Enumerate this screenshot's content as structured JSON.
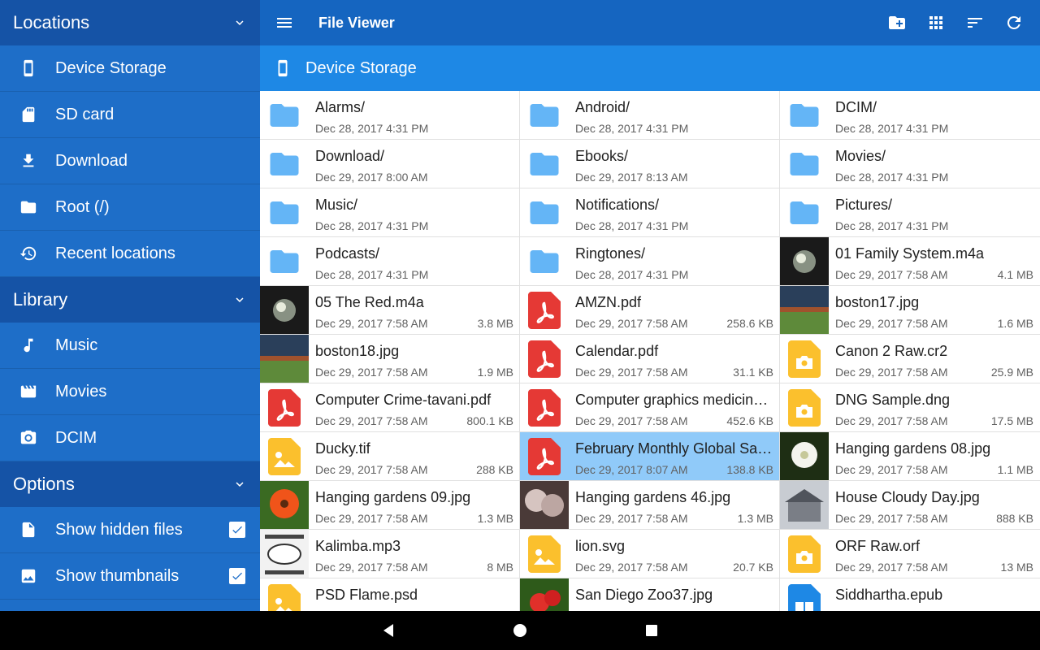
{
  "sidebar": {
    "sections": [
      {
        "title": "Locations",
        "items": [
          {
            "label": "Device Storage",
            "icon": "phone-icon"
          },
          {
            "label": "SD card",
            "icon": "sd-card-icon"
          },
          {
            "label": "Download",
            "icon": "download-icon"
          },
          {
            "label": "Root (/)",
            "icon": "folder-icon"
          },
          {
            "label": "Recent locations",
            "icon": "history-icon"
          }
        ]
      },
      {
        "title": "Library",
        "items": [
          {
            "label": "Music",
            "icon": "music-note-icon"
          },
          {
            "label": "Movies",
            "icon": "movie-icon"
          },
          {
            "label": "DCIM",
            "icon": "camera-icon"
          }
        ]
      },
      {
        "title": "Options",
        "items": [
          {
            "label": "Show hidden files",
            "icon": "file-icon",
            "checked": true
          },
          {
            "label": "Show thumbnails",
            "icon": "image-icon",
            "checked": true
          }
        ]
      }
    ]
  },
  "topbar": {
    "title": "File Viewer",
    "actions": [
      "new-folder-icon",
      "grid-view-icon",
      "sort-icon",
      "refresh-icon"
    ]
  },
  "pathbar": {
    "label": "Device Storage"
  },
  "colors": {
    "folder": "#64b5f6",
    "pdf": "#e53935",
    "image": "#fbc02d",
    "selected": "#90caf9",
    "epub": "#1e88e5"
  },
  "files": [
    {
      "name": "Alarms/",
      "date": "Dec 28, 2017 4:31 PM",
      "size": "",
      "type": "folder"
    },
    {
      "name": "Android/",
      "date": "Dec 28, 2017 4:31 PM",
      "size": "",
      "type": "folder"
    },
    {
      "name": "DCIM/",
      "date": "Dec 28, 2017 4:31 PM",
      "size": "",
      "type": "folder"
    },
    {
      "name": "Download/",
      "date": "Dec 29, 2017 8:00 AM",
      "size": "",
      "type": "folder"
    },
    {
      "name": "Ebooks/",
      "date": "Dec 29, 2017 8:13 AM",
      "size": "",
      "type": "folder"
    },
    {
      "name": "Movies/",
      "date": "Dec 28, 2017 4:31 PM",
      "size": "",
      "type": "folder"
    },
    {
      "name": "Music/",
      "date": "Dec 28, 2017 4:31 PM",
      "size": "",
      "type": "folder"
    },
    {
      "name": "Notifications/",
      "date": "Dec 28, 2017 4:31 PM",
      "size": "",
      "type": "folder"
    },
    {
      "name": "Pictures/",
      "date": "Dec 28, 2017 4:31 PM",
      "size": "",
      "type": "folder"
    },
    {
      "name": "Podcasts/",
      "date": "Dec 28, 2017 4:31 PM",
      "size": "",
      "type": "folder"
    },
    {
      "name": "Ringtones/",
      "date": "Dec 28, 2017 4:31 PM",
      "size": "",
      "type": "folder"
    },
    {
      "name": "01 Family System.m4a",
      "date": "Dec 29, 2017 7:58 AM",
      "size": "4.1 MB",
      "type": "photo",
      "thumb": "dark"
    },
    {
      "name": "05 The Red.m4a",
      "date": "Dec 29, 2017 7:58 AM",
      "size": "3.8 MB",
      "type": "photo",
      "thumb": "dark"
    },
    {
      "name": "AMZN.pdf",
      "date": "Dec 29, 2017 7:58 AM",
      "size": "258.6 KB",
      "type": "pdf"
    },
    {
      "name": "boston17.jpg",
      "date": "Dec 29, 2017 7:58 AM",
      "size": "1.6 MB",
      "type": "photo",
      "thumb": "stadium"
    },
    {
      "name": "boston18.jpg",
      "date": "Dec 29, 2017 7:58 AM",
      "size": "1.9 MB",
      "type": "photo",
      "thumb": "stadium"
    },
    {
      "name": "Calendar.pdf",
      "date": "Dec 29, 2017 7:58 AM",
      "size": "31.1 KB",
      "type": "pdf"
    },
    {
      "name": "Canon 2 Raw.cr2",
      "date": "Dec 29, 2017 7:58 AM",
      "size": "25.9 MB",
      "type": "raw"
    },
    {
      "name": "Computer Crime-tavani.pdf",
      "date": "Dec 29, 2017 7:58 AM",
      "size": "800.1 KB",
      "type": "pdf"
    },
    {
      "name": "Computer graphics medicine.…",
      "date": "Dec 29, 2017 7:58 AM",
      "size": "452.6 KB",
      "type": "pdf"
    },
    {
      "name": "DNG Sample.dng",
      "date": "Dec 29, 2017 7:58 AM",
      "size": "17.5 MB",
      "type": "raw"
    },
    {
      "name": "Ducky.tif",
      "date": "Dec 29, 2017 7:58 AM",
      "size": "288 KB",
      "type": "image"
    },
    {
      "name": "February Monthly Global Sale…",
      "date": "Dec 29, 2017 8:07 AM",
      "size": "138.8 KB",
      "type": "pdf",
      "selected": true
    },
    {
      "name": "Hanging gardens 08.jpg",
      "date": "Dec 29, 2017 7:58 AM",
      "size": "1.1 MB",
      "type": "photo",
      "thumb": "white-flower"
    },
    {
      "name": "Hanging gardens 09.jpg",
      "date": "Dec 29, 2017 7:58 AM",
      "size": "1.3 MB",
      "type": "photo",
      "thumb": "orange-flower"
    },
    {
      "name": "Hanging gardens 46.jpg",
      "date": "Dec 29, 2017 7:58 AM",
      "size": "1.3 MB",
      "type": "photo",
      "thumb": "pink-tree"
    },
    {
      "name": "House Cloudy Day.jpg",
      "date": "Dec 29, 2017 7:58 AM",
      "size": "888 KB",
      "type": "photo",
      "thumb": "house"
    },
    {
      "name": "Kalimba.mp3",
      "date": "Dec 29, 2017 7:58 AM",
      "size": "8 MB",
      "type": "photo",
      "thumb": "album-art"
    },
    {
      "name": "lion.svg",
      "date": "Dec 29, 2017 7:58 AM",
      "size": "20.7 KB",
      "type": "image"
    },
    {
      "name": "ORF Raw.orf",
      "date": "Dec 29, 2017 7:58 AM",
      "size": "13 MB",
      "type": "raw"
    },
    {
      "name": "PSD Flame.psd",
      "date": "",
      "size": "",
      "type": "image"
    },
    {
      "name": "San Diego Zoo37.jpg",
      "date": "",
      "size": "",
      "type": "photo",
      "thumb": "red-flower"
    },
    {
      "name": "Siddhartha.epub",
      "date": "",
      "size": "",
      "type": "epub"
    }
  ],
  "navbar": [
    "back-icon",
    "home-icon",
    "recents-icon"
  ]
}
